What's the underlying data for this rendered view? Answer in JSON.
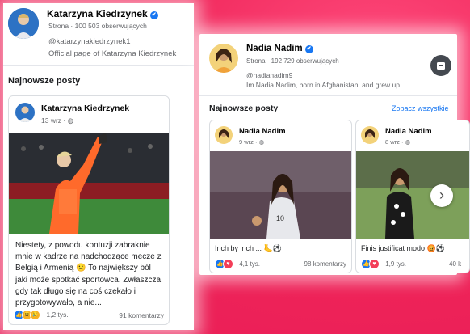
{
  "left_page": {
    "name": "Katarzyna Kiedrzynek",
    "stats": "Strona · 100 503 obserwujących",
    "handle": "@katarzynakiedrzynek1",
    "bio": "Official page of Katarzyna Kiedrzynek",
    "section_title": "Najnowsze posty",
    "post": {
      "author": "Katarzyna Kiedrzynek",
      "date": "13 wrz · ",
      "text": "Niestety, z powodu kontuzji zabraknie mnie w kadrze na nadchodzące mecze z Belgią i Armenią 🙁 To największy ból jaki może spotkać sportowca. Zwłaszcza, gdy tak długo się na coś czekało i przygotowywało, a nie...",
      "reactions": "1,2 tys.",
      "comments": "91 komentarzy"
    }
  },
  "right_page": {
    "name": "Nadia Nadim",
    "stats": "Strona · 192 729 obserwujących",
    "handle": "@nadianadim9",
    "bio": "Im Nadia Nadim, born in Afghanistan, and grew up...",
    "section_title": "Najnowsze posty",
    "see_all": "Zobacz wszystkie",
    "posts": [
      {
        "author": "Nadia Nadim",
        "date": "9 wrz · ",
        "text": "Inch by inch ... 🦶⚽",
        "reactions": "4,1 tys.",
        "comments": "98 komentarzy"
      },
      {
        "author": "Nadia Nadim",
        "date": "8 wrz · ",
        "text": "Finis justificat modo 😡⚽",
        "reactions": "1,9 tys.",
        "comments": "40 k"
      }
    ]
  },
  "icons": {
    "verified": "✔",
    "globe": "◍",
    "next": "›"
  },
  "colors": {
    "background": "#f0265a",
    "accent": "#1877f2"
  }
}
